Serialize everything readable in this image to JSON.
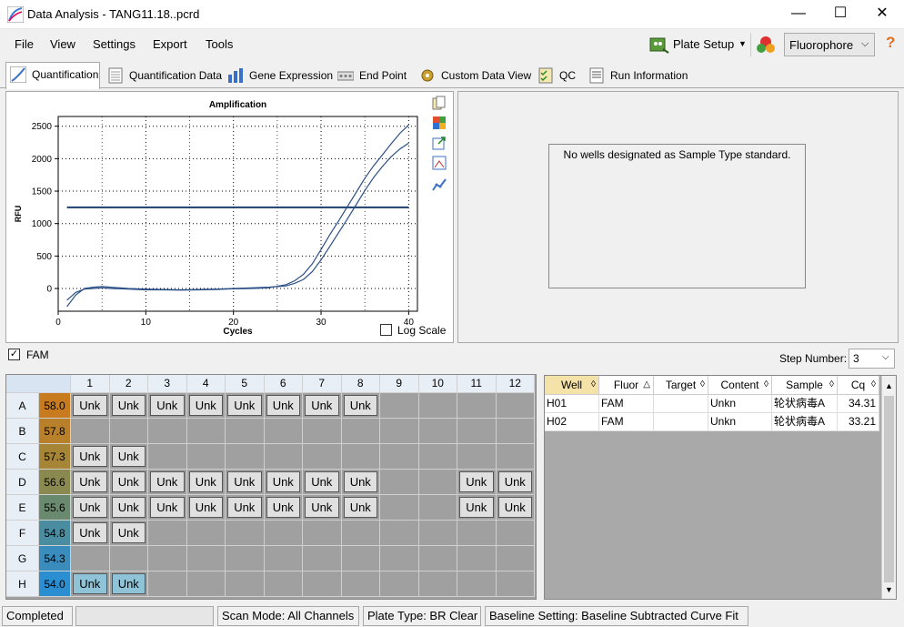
{
  "window": {
    "title": "Data Analysis - TANG11.18..pcrd",
    "min": "—",
    "max": "☐",
    "close": "✕"
  },
  "menu": [
    {
      "label": "File"
    },
    {
      "label": "View"
    },
    {
      "label": "Settings"
    },
    {
      "label": "Export"
    },
    {
      "label": "Tools"
    }
  ],
  "toolbar": {
    "plate_setup": "Plate Setup",
    "fluorophore": "Fluorophore",
    "help": "?"
  },
  "tabs": [
    {
      "label": "Quantification"
    },
    {
      "label": "Quantification Data"
    },
    {
      "label": "Gene Expression"
    },
    {
      "label": "End Point"
    },
    {
      "label": "Custom Data View"
    },
    {
      "label": "QC"
    },
    {
      "label": "Run Information"
    }
  ],
  "chart_data": {
    "type": "line",
    "title": "Amplification",
    "xlabel": "Cycles",
    "ylabel": "RFU",
    "xlim": [
      0,
      41
    ],
    "ylim": [
      -350,
      2650
    ],
    "xticks": [
      0,
      10,
      20,
      30,
      40
    ],
    "yticks": [
      0,
      500,
      1000,
      1500,
      2000,
      2500
    ],
    "grid": true,
    "threshold": 1250,
    "series": [
      {
        "x": [
          1,
          2,
          3,
          4,
          5,
          6,
          8,
          10,
          12,
          14,
          16,
          18,
          20,
          22,
          24,
          26,
          27,
          28,
          29,
          30,
          31,
          32,
          33,
          34,
          35,
          36,
          37,
          38,
          39,
          40
        ],
        "values": [
          -180,
          -60,
          -10,
          0,
          10,
          0,
          -10,
          -20,
          -20,
          -25,
          -20,
          -15,
          -5,
          0,
          10,
          60,
          120,
          220,
          380,
          600,
          830,
          1040,
          1260,
          1480,
          1700,
          1890,
          2060,
          2230,
          2390,
          2520
        ]
      },
      {
        "x": [
          1,
          2,
          3,
          4,
          5,
          6,
          8,
          10,
          12,
          14,
          16,
          18,
          20,
          22,
          24,
          26,
          27,
          28,
          29,
          30,
          31,
          32,
          33,
          34,
          35,
          36,
          37,
          38,
          39,
          40
        ],
        "values": [
          -280,
          -100,
          0,
          20,
          30,
          20,
          0,
          -10,
          -15,
          -20,
          -15,
          -10,
          0,
          10,
          20,
          40,
          80,
          140,
          260,
          440,
          650,
          860,
          1070,
          1290,
          1510,
          1710,
          1880,
          2030,
          2150,
          2240
        ]
      }
    ]
  },
  "log_scale_label": "Log Scale",
  "no_standard_msg": "No wells designated as Sample Type standard.",
  "fam_label": "FAM",
  "step_number_label": "Step Number:",
  "step_number_value": "3",
  "plate": {
    "columns": [
      "1",
      "2",
      "3",
      "4",
      "5",
      "6",
      "7",
      "8",
      "9",
      "10",
      "11",
      "12"
    ],
    "rows": [
      {
        "label": "A",
        "temp": "58.0",
        "color": "#c87a1e",
        "wells": [
          "Unk",
          "Unk",
          "Unk",
          "Unk",
          "Unk",
          "Unk",
          "Unk",
          "Unk",
          "",
          "",
          "",
          ""
        ]
      },
      {
        "label": "B",
        "temp": "57.8",
        "color": "#b8802a",
        "wells": [
          "",
          "",
          "",
          "",
          "",
          "",
          "",
          "",
          "",
          "",
          "",
          ""
        ]
      },
      {
        "label": "C",
        "temp": "57.3",
        "color": "#a68636",
        "wells": [
          "Unk",
          "Unk",
          "",
          "",
          "",
          "",
          "",
          "",
          "",
          "",
          "",
          ""
        ]
      },
      {
        "label": "D",
        "temp": "56.6",
        "color": "#8a8a50",
        "wells": [
          "Unk",
          "Unk",
          "Unk",
          "Unk",
          "Unk",
          "Unk",
          "Unk",
          "Unk",
          "",
          "",
          "Unk",
          "Unk"
        ]
      },
      {
        "label": "E",
        "temp": "55.6",
        "color": "#6a8a70",
        "wells": [
          "Unk",
          "Unk",
          "Unk",
          "Unk",
          "Unk",
          "Unk",
          "Unk",
          "Unk",
          "",
          "",
          "Unk",
          "Unk"
        ]
      },
      {
        "label": "F",
        "temp": "54.8",
        "color": "#4a8ca0",
        "wells": [
          "Unk",
          "Unk",
          "",
          "",
          "",
          "",
          "",
          "",
          "",
          "",
          "",
          ""
        ]
      },
      {
        "label": "G",
        "temp": "54.3",
        "color": "#3a8cbc",
        "wells": [
          "",
          "",
          "",
          "",
          "",
          "",
          "",
          "",
          "",
          "",
          "",
          ""
        ]
      },
      {
        "label": "H",
        "temp": "54.0",
        "color": "#2a8ed0",
        "wells": [
          "Unk",
          "Unk",
          "",
          "",
          "",
          "",
          "",
          "",
          "",
          "",
          "",
          ""
        ]
      }
    ]
  },
  "table": {
    "headers": [
      "Well",
      "Fluor",
      "Target",
      "Content",
      "Sample",
      "Cq"
    ],
    "rows": [
      {
        "well": "H01",
        "fluor": "FAM",
        "target": "",
        "content": "Unkn",
        "sample": "轮状病毒A",
        "cq": "34.31"
      },
      {
        "well": "H02",
        "fluor": "FAM",
        "target": "",
        "content": "Unkn",
        "sample": "轮状病毒A",
        "cq": "33.21"
      }
    ]
  },
  "status": {
    "state": "Completed",
    "scan_mode": "Scan Mode: All Channels",
    "plate_type": "Plate Type: BR Clear",
    "baseline": "Baseline Setting: Baseline Subtracted Curve Fit"
  },
  "colors": {
    "curve": "#2b4f86",
    "threshold": "#1c3f6b",
    "accent": "#0078d7"
  }
}
